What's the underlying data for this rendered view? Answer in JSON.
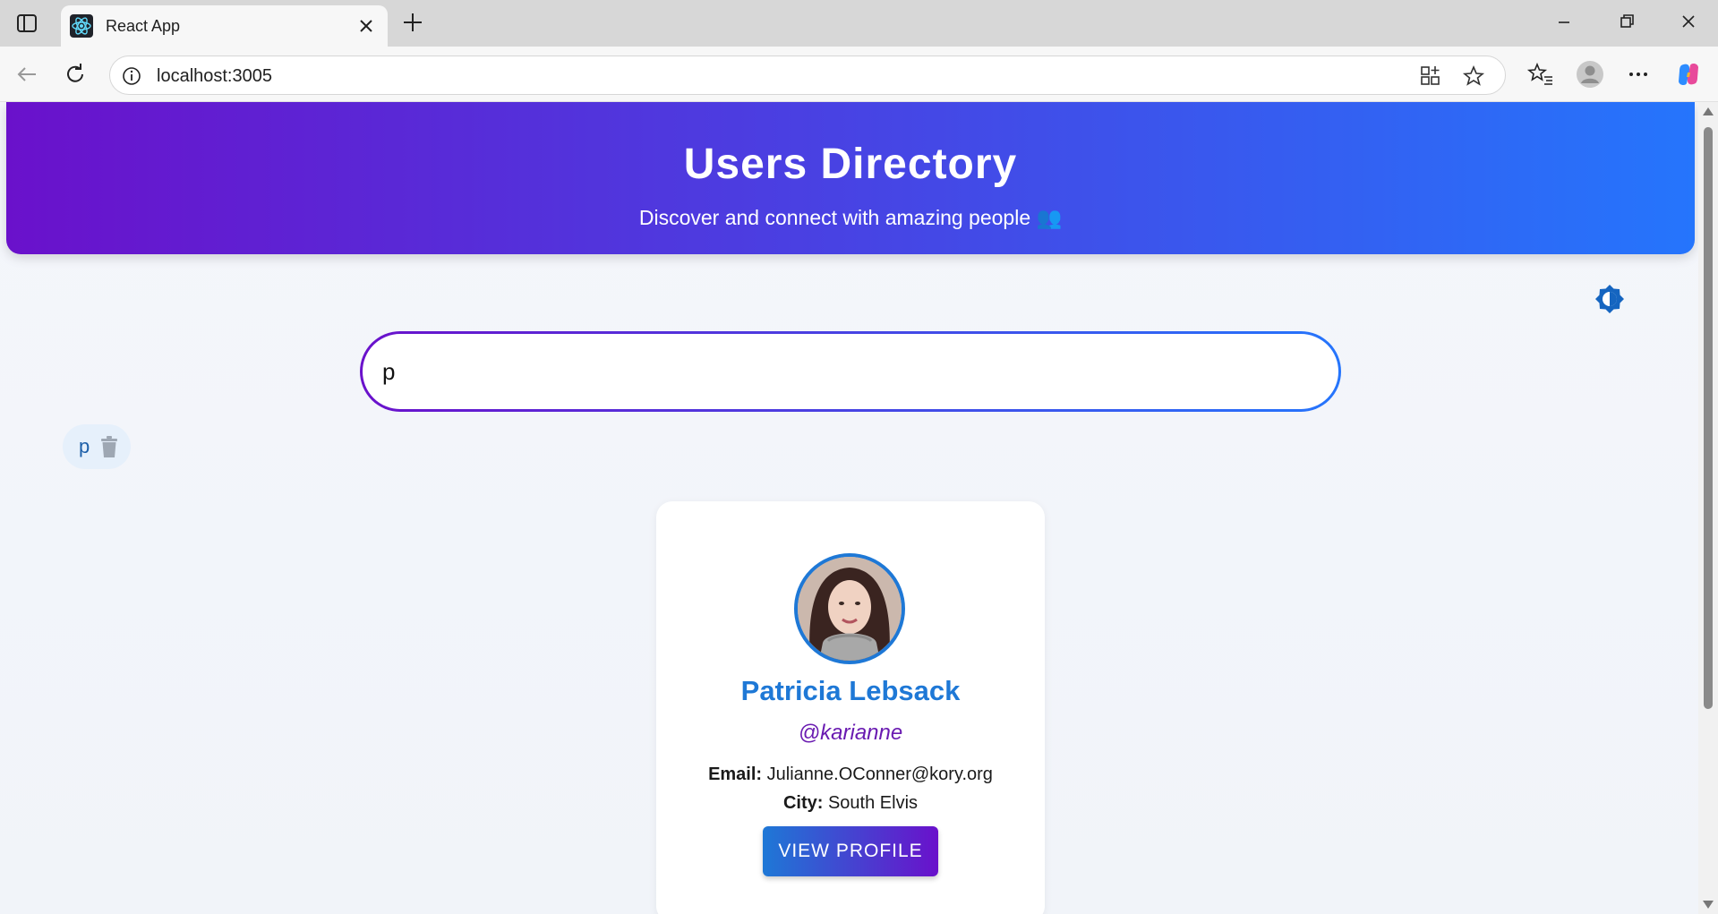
{
  "browser": {
    "tab_title": "React App",
    "url": "localhost:3005",
    "icons": [
      "sidebar-icon",
      "react-favicon",
      "close-icon",
      "new-tab-icon",
      "minimize-icon",
      "restore-icon",
      "window-close-icon",
      "back-icon",
      "refresh-icon",
      "info-icon",
      "app-available-icon",
      "favorite-star-icon",
      "favorites-icon",
      "profile-avatar-icon",
      "more-icon",
      "copilot-icon"
    ]
  },
  "header": {
    "title": "Users Directory",
    "subtitle": "Discover and connect with amazing people 👥"
  },
  "search": {
    "value": "p",
    "placeholder": ""
  },
  "recent_searches": [
    {
      "label": "p"
    }
  ],
  "users": [
    {
      "name": "Patricia Lebsack",
      "username": "@karianne",
      "email_label": "Email:",
      "email": "Julianne.OConner@kory.org",
      "city_label": "City:",
      "city": "South Elvis",
      "button_label": "VIEW PROFILE"
    }
  ],
  "colors": {
    "gradient_start": "#6a11cb",
    "gradient_end": "#2575fc",
    "accent_blue": "#1e78d6",
    "accent_purple": "#6a1bb1"
  }
}
